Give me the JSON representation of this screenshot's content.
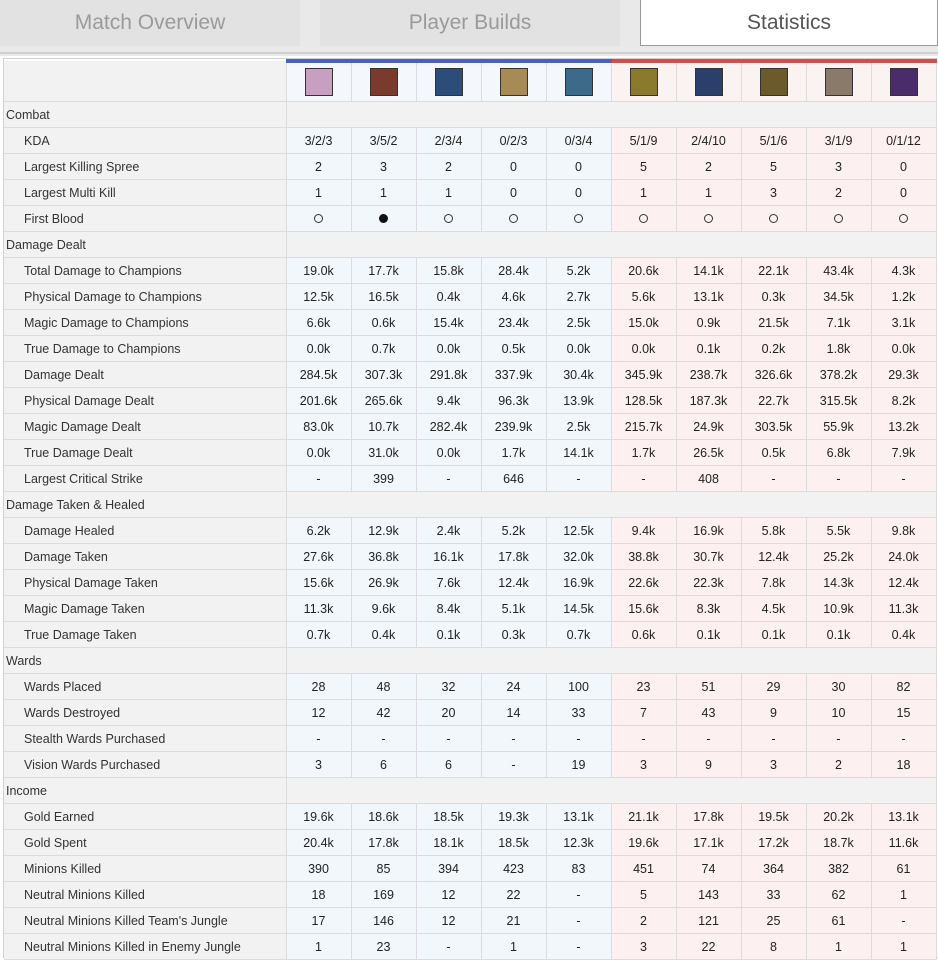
{
  "tabs": [
    {
      "label": "Match Overview"
    },
    {
      "label": "Player Builds"
    },
    {
      "label": "Statistics"
    }
  ],
  "champions": [
    {
      "icon": "champion-1-portrait-icon",
      "team": "blue",
      "color": "#c79fc0"
    },
    {
      "icon": "champion-2-portrait-icon",
      "team": "blue",
      "color": "#7a3a2c"
    },
    {
      "icon": "champion-3-portrait-icon",
      "team": "blue",
      "color": "#2c4c7a"
    },
    {
      "icon": "champion-4-portrait-icon",
      "team": "blue",
      "color": "#a88a56"
    },
    {
      "icon": "champion-5-portrait-icon",
      "team": "blue",
      "color": "#3b6a8a"
    },
    {
      "icon": "champion-6-portrait-icon",
      "team": "red",
      "color": "#8a7a2c"
    },
    {
      "icon": "champion-7-portrait-icon",
      "team": "red",
      "color": "#2c3e6a"
    },
    {
      "icon": "champion-8-portrait-icon",
      "team": "red",
      "color": "#6a5a2c"
    },
    {
      "icon": "champion-9-portrait-icon",
      "team": "red",
      "color": "#8a7a6a"
    },
    {
      "icon": "champion-10-portrait-icon",
      "team": "red",
      "color": "#4a2c6a"
    }
  ],
  "colors": {
    "blue_team": "#4a5fc8",
    "red_team": "#d94a4a"
  },
  "sections": [
    {
      "title": "Combat",
      "rows": [
        {
          "label": "KDA",
          "values": [
            "3/2/3",
            "3/5/2",
            "2/3/4",
            "0/2/3",
            "0/3/4",
            "5/1/9",
            "2/4/10",
            "5/1/6",
            "3/1/9",
            "0/1/12"
          ]
        },
        {
          "label": "Largest Killing Spree",
          "values": [
            "2",
            "3",
            "2",
            "0",
            "0",
            "5",
            "2",
            "5",
            "3",
            "0"
          ]
        },
        {
          "label": "Largest Multi Kill",
          "values": [
            "1",
            "1",
            "1",
            "0",
            "0",
            "1",
            "1",
            "3",
            "2",
            "0"
          ]
        },
        {
          "label": "First Blood",
          "type": "dots",
          "values": [
            false,
            true,
            false,
            false,
            false,
            false,
            false,
            false,
            false,
            false
          ]
        }
      ]
    },
    {
      "title": "Damage Dealt",
      "rows": [
        {
          "label": "Total Damage to Champions",
          "values": [
            "19.0k",
            "17.7k",
            "15.8k",
            "28.4k",
            "5.2k",
            "20.6k",
            "14.1k",
            "22.1k",
            "43.4k",
            "4.3k"
          ]
        },
        {
          "label": "Physical Damage to Champions",
          "values": [
            "12.5k",
            "16.5k",
            "0.4k",
            "4.6k",
            "2.7k",
            "5.6k",
            "13.1k",
            "0.3k",
            "34.5k",
            "1.2k"
          ]
        },
        {
          "label": "Magic Damage to Champions",
          "values": [
            "6.6k",
            "0.6k",
            "15.4k",
            "23.4k",
            "2.5k",
            "15.0k",
            "0.9k",
            "21.5k",
            "7.1k",
            "3.1k"
          ]
        },
        {
          "label": "True Damage to Champions",
          "values": [
            "0.0k",
            "0.7k",
            "0.0k",
            "0.5k",
            "0.0k",
            "0.0k",
            "0.1k",
            "0.2k",
            "1.8k",
            "0.0k"
          ]
        },
        {
          "label": "Damage Dealt",
          "values": [
            "284.5k",
            "307.3k",
            "291.8k",
            "337.9k",
            "30.4k",
            "345.9k",
            "238.7k",
            "326.6k",
            "378.2k",
            "29.3k"
          ]
        },
        {
          "label": "Physical Damage Dealt",
          "values": [
            "201.6k",
            "265.6k",
            "9.4k",
            "96.3k",
            "13.9k",
            "128.5k",
            "187.3k",
            "22.7k",
            "315.5k",
            "8.2k"
          ]
        },
        {
          "label": "Magic Damage Dealt",
          "values": [
            "83.0k",
            "10.7k",
            "282.4k",
            "239.9k",
            "2.5k",
            "215.7k",
            "24.9k",
            "303.5k",
            "55.9k",
            "13.2k"
          ]
        },
        {
          "label": "True Damage Dealt",
          "values": [
            "0.0k",
            "31.0k",
            "0.0k",
            "1.7k",
            "14.1k",
            "1.7k",
            "26.5k",
            "0.5k",
            "6.8k",
            "7.9k"
          ]
        },
        {
          "label": "Largest Critical Strike",
          "values": [
            "-",
            "399",
            "-",
            "646",
            "-",
            "-",
            "408",
            "-",
            "-",
            "-"
          ]
        }
      ]
    },
    {
      "title": "Damage Taken & Healed",
      "rows": [
        {
          "label": "Damage Healed",
          "values": [
            "6.2k",
            "12.9k",
            "2.4k",
            "5.2k",
            "12.5k",
            "9.4k",
            "16.9k",
            "5.8k",
            "5.5k",
            "9.8k"
          ]
        },
        {
          "label": "Damage Taken",
          "values": [
            "27.6k",
            "36.8k",
            "16.1k",
            "17.8k",
            "32.0k",
            "38.8k",
            "30.7k",
            "12.4k",
            "25.2k",
            "24.0k"
          ]
        },
        {
          "label": "Physical Damage Taken",
          "values": [
            "15.6k",
            "26.9k",
            "7.6k",
            "12.4k",
            "16.9k",
            "22.6k",
            "22.3k",
            "7.8k",
            "14.3k",
            "12.4k"
          ]
        },
        {
          "label": "Magic Damage Taken",
          "values": [
            "11.3k",
            "9.6k",
            "8.4k",
            "5.1k",
            "14.5k",
            "15.6k",
            "8.3k",
            "4.5k",
            "10.9k",
            "11.3k"
          ]
        },
        {
          "label": "True Damage Taken",
          "values": [
            "0.7k",
            "0.4k",
            "0.1k",
            "0.3k",
            "0.7k",
            "0.6k",
            "0.1k",
            "0.1k",
            "0.1k",
            "0.4k"
          ]
        }
      ]
    },
    {
      "title": "Wards",
      "rows": [
        {
          "label": "Wards Placed",
          "values": [
            "28",
            "48",
            "32",
            "24",
            "100",
            "23",
            "51",
            "29",
            "30",
            "82"
          ]
        },
        {
          "label": "Wards Destroyed",
          "values": [
            "12",
            "42",
            "20",
            "14",
            "33",
            "7",
            "43",
            "9",
            "10",
            "15"
          ]
        },
        {
          "label": "Stealth Wards Purchased",
          "values": [
            "-",
            "-",
            "-",
            "-",
            "-",
            "-",
            "-",
            "-",
            "-",
            "-"
          ]
        },
        {
          "label": "Vision Wards Purchased",
          "values": [
            "3",
            "6",
            "6",
            "-",
            "19",
            "3",
            "9",
            "3",
            "2",
            "18"
          ]
        }
      ]
    },
    {
      "title": "Income",
      "rows": [
        {
          "label": "Gold Earned",
          "values": [
            "19.6k",
            "18.6k",
            "18.5k",
            "19.3k",
            "13.1k",
            "21.1k",
            "17.8k",
            "19.5k",
            "20.2k",
            "13.1k"
          ]
        },
        {
          "label": "Gold Spent",
          "values": [
            "20.4k",
            "17.8k",
            "18.1k",
            "18.5k",
            "12.3k",
            "19.6k",
            "17.1k",
            "17.2k",
            "18.7k",
            "11.6k"
          ]
        },
        {
          "label": "Minions Killed",
          "values": [
            "390",
            "85",
            "394",
            "423",
            "83",
            "451",
            "74",
            "364",
            "382",
            "61"
          ]
        },
        {
          "label": "Neutral Minions Killed",
          "values": [
            "18",
            "169",
            "12",
            "22",
            "-",
            "5",
            "143",
            "33",
            "62",
            "1"
          ]
        },
        {
          "label": "Neutral Minions Killed Team's Jungle",
          "values": [
            "17",
            "146",
            "12",
            "21",
            "-",
            "2",
            "121",
            "25",
            "61",
            "-"
          ]
        },
        {
          "label": "Neutral Minions Killed in Enemy Jungle",
          "values": [
            "1",
            "23",
            "-",
            "1",
            "-",
            "3",
            "22",
            "8",
            "1",
            "1"
          ]
        }
      ]
    }
  ]
}
